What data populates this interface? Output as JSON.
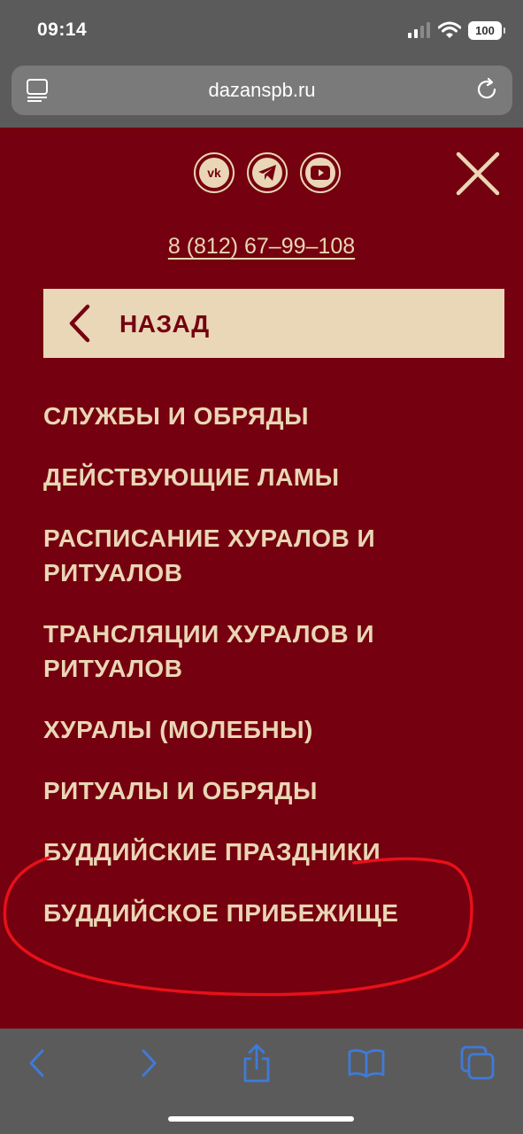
{
  "status_bar": {
    "time": "09:14",
    "battery": "100"
  },
  "browser": {
    "url": "dazanspb.ru"
  },
  "page": {
    "social": [
      "vk-icon",
      "telegram-icon",
      "youtube-icon"
    ],
    "vk_text": "vk",
    "phone": "8 (812) 67–99–108",
    "back_label": "НАЗАД",
    "menu": [
      "СЛУЖБЫ И ОБРЯДЫ",
      "ДЕЙСТВУЮЩИЕ ЛАМЫ",
      "РАСПИСАНИЕ ХУРАЛОВ И РИТУАЛОВ",
      "ТРАНСЛЯЦИИ ХУРАЛОВ И РИТУАЛОВ",
      "ХУРАЛЫ (МОЛЕБНЫ)",
      "РИТУАЛЫ И ОБРЯДЫ",
      "БУДДИЙСКИЕ ПРАЗДНИКИ",
      "БУДДИЙСКОЕ ПРИБЕЖИЩЕ"
    ],
    "colors": {
      "background": "#75000f",
      "accent": "#ead6b6",
      "back_button": "#e9d7b8",
      "annotation": "#e8101a"
    }
  },
  "toolbar": [
    "back-icon",
    "forward-icon",
    "share-icon",
    "bookmarks-icon",
    "tabs-icon"
  ]
}
